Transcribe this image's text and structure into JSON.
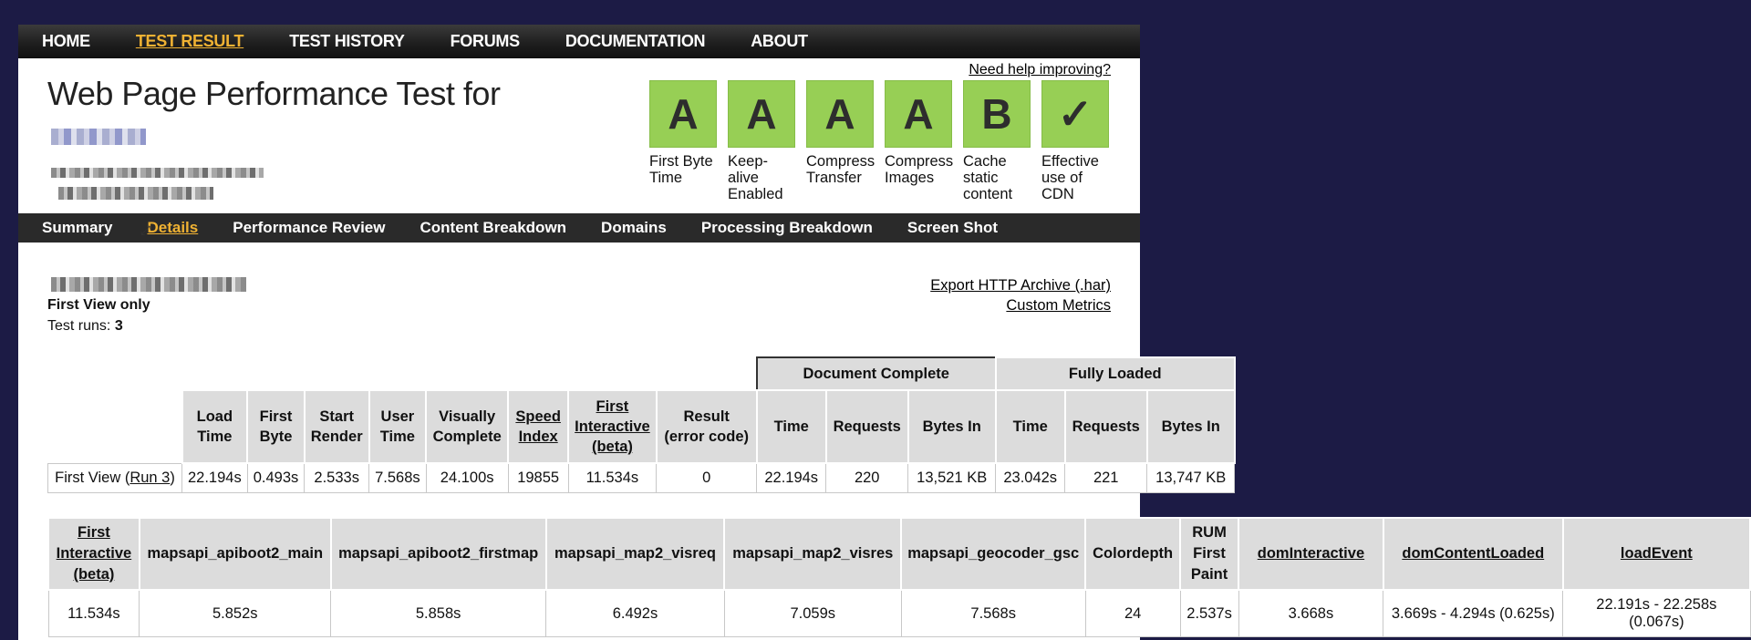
{
  "topnav": {
    "items": [
      "HOME",
      "TEST RESULT",
      "TEST HISTORY",
      "FORUMS",
      "DOCUMENTATION",
      "ABOUT"
    ],
    "active_index": 1
  },
  "header": {
    "title": "Web Page Performance Test for",
    "help_link": "Need help improving?"
  },
  "grades": [
    {
      "grade": "A",
      "label": "First Byte Time"
    },
    {
      "grade": "A",
      "label": "Keep-alive Enabled"
    },
    {
      "grade": "A",
      "label": "Compress Transfer"
    },
    {
      "grade": "A",
      "label": "Compress Images"
    },
    {
      "grade": "B",
      "label": "Cache static content"
    },
    {
      "grade": "✓",
      "label": "Effective use of CDN"
    }
  ],
  "subnav": {
    "items": [
      "Summary",
      "Details",
      "Performance Review",
      "Content Breakdown",
      "Domains",
      "Processing Breakdown",
      "Screen Shot"
    ],
    "active_index": 1
  },
  "popout_icon": "external-link-icon",
  "info": {
    "first_view_only": "First View only",
    "test_runs_label": "Test runs: ",
    "test_runs_value": "3"
  },
  "links": {
    "export_har": "Export HTTP Archive (.har)",
    "custom_metrics": "Custom Metrics"
  },
  "summary_table": {
    "group_headers": {
      "document_complete": "Document Complete",
      "fully_loaded": "Fully Loaded"
    },
    "headers": {
      "load_time": "Load Time",
      "first_byte": "First Byte",
      "start_render": "Start Render",
      "user_time": "User Time",
      "visually_complete": "Visually Complete",
      "speed_index": "Speed Index",
      "first_interactive": "First Interactive (beta)",
      "result": "Result (error code)",
      "dc_time": "Time",
      "dc_requests": "Requests",
      "dc_bytes": "Bytes In",
      "fl_time": "Time",
      "fl_requests": "Requests",
      "fl_bytes": "Bytes In"
    },
    "row": {
      "label_prefix": "First View (",
      "run_link": "Run 3",
      "label_suffix": ")",
      "load_time": "22.194s",
      "first_byte": "0.493s",
      "start_render": "2.533s",
      "user_time": "7.568s",
      "visually_complete": "24.100s",
      "speed_index": "19855",
      "first_interactive": "11.534s",
      "result": "0",
      "dc_time": "22.194s",
      "dc_requests": "220",
      "dc_bytes": "13,521 KB",
      "fl_time": "23.042s",
      "fl_requests": "221",
      "fl_bytes": "13,747 KB"
    }
  },
  "metrics_table": {
    "headers": {
      "first_interactive": "First Interactive (beta)",
      "m1": "mapsapi_apiboot2_main",
      "m2": "mapsapi_apiboot2_firstmap",
      "m3": "mapsapi_map2_visreq",
      "m4": "mapsapi_map2_visres",
      "m5": "mapsapi_geocoder_gsc",
      "colordepth": "Colordepth",
      "rum": "RUM First Paint",
      "dom_interactive": "domInteractive",
      "dom_content_loaded": "domContentLoaded",
      "load_event": "loadEvent"
    },
    "row": {
      "first_interactive": "11.534s",
      "m1": "5.852s",
      "m2": "5.858s",
      "m3": "6.492s",
      "m4": "7.059s",
      "m5": "7.568s",
      "colordepth": "24",
      "rum": "2.537s",
      "dom_interactive": "3.668s",
      "dom_content_loaded": "3.669s - 4.294s (0.625s)",
      "load_event": "22.191s - 22.258s (0.067s)"
    }
  }
}
